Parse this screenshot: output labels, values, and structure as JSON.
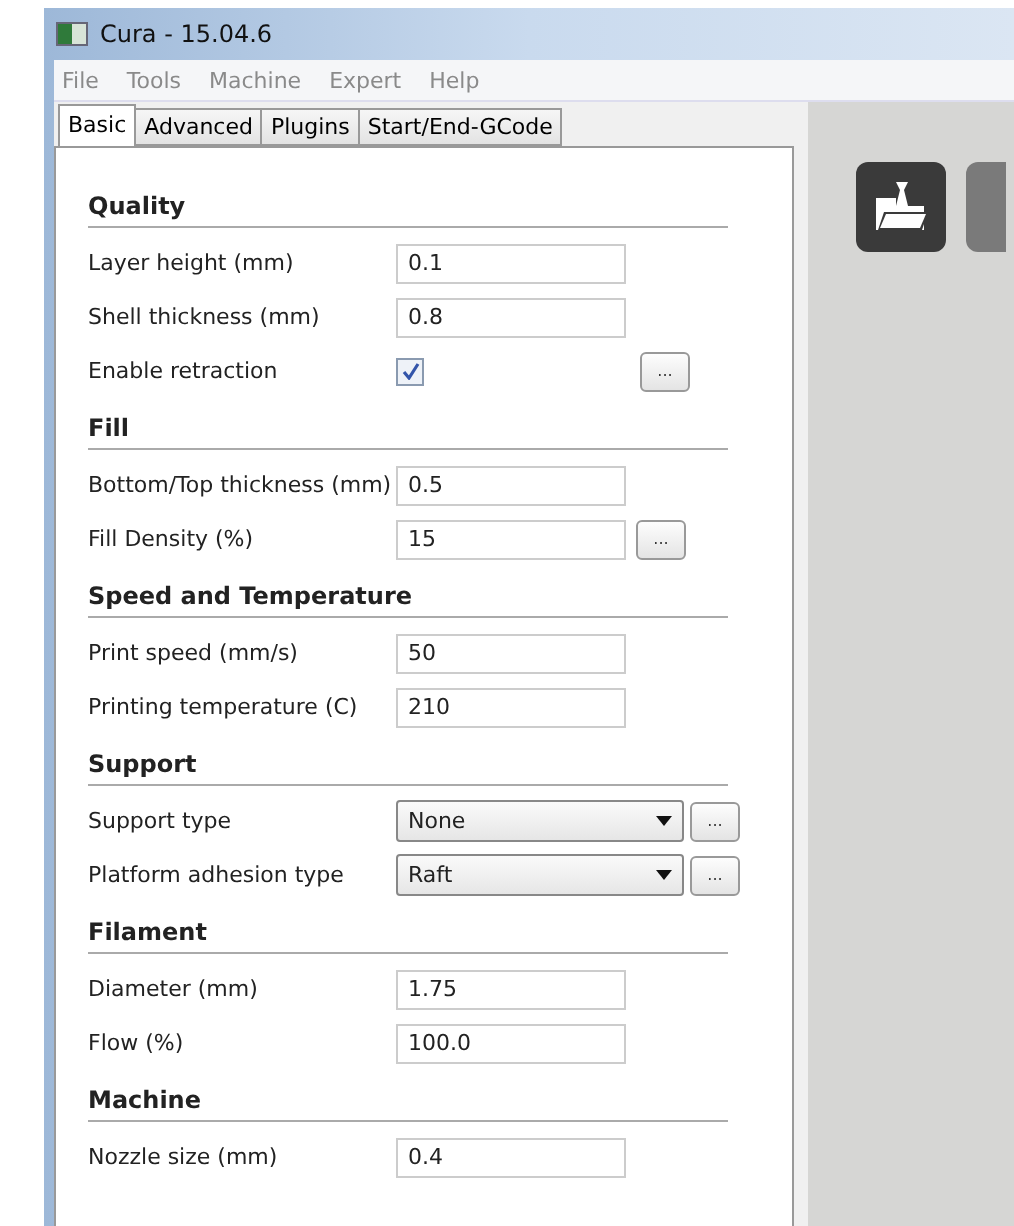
{
  "window": {
    "title": "Cura - 15.04.6"
  },
  "menu": [
    "File",
    "Tools",
    "Machine",
    "Expert",
    "Help"
  ],
  "tabs": [
    {
      "label": "Basic",
      "selected": true
    },
    {
      "label": "Advanced",
      "selected": false
    },
    {
      "label": "Plugins",
      "selected": false
    },
    {
      "label": "Start/End-GCode",
      "selected": false
    }
  ],
  "sections": [
    {
      "title": "Quality",
      "rows": [
        {
          "kind": "text",
          "label": "Layer height (mm)",
          "value": "0.1"
        },
        {
          "kind": "text",
          "label": "Shell thickness (mm)",
          "value": "0.8"
        },
        {
          "kind": "checkbox",
          "label": "Enable retraction",
          "checked": true,
          "more": "..."
        }
      ]
    },
    {
      "title": "Fill",
      "rows": [
        {
          "kind": "text",
          "label": "Bottom/Top thickness (mm)",
          "value": "0.5"
        },
        {
          "kind": "text",
          "label": "Fill Density (%)",
          "value": "15",
          "more": "..."
        }
      ]
    },
    {
      "title": "Speed and Temperature",
      "rows": [
        {
          "kind": "text",
          "label": "Print speed (mm/s)",
          "value": "50"
        },
        {
          "kind": "text",
          "label": "Printing temperature (C)",
          "value": "210"
        }
      ]
    },
    {
      "title": "Support",
      "rows": [
        {
          "kind": "dropdown",
          "label": "Support type",
          "value": "None",
          "more": "..."
        },
        {
          "kind": "dropdown",
          "label": "Platform adhesion type",
          "value": "Raft",
          "more": "..."
        }
      ]
    },
    {
      "title": "Filament",
      "rows": [
        {
          "kind": "text",
          "label": "Diameter (mm)",
          "value": "1.75"
        },
        {
          "kind": "text",
          "label": "Flow (%)",
          "value": "100.0"
        }
      ]
    },
    {
      "title": "Machine",
      "rows": [
        {
          "kind": "text",
          "label": "Nozzle size (mm)",
          "value": "0.4"
        }
      ]
    }
  ]
}
